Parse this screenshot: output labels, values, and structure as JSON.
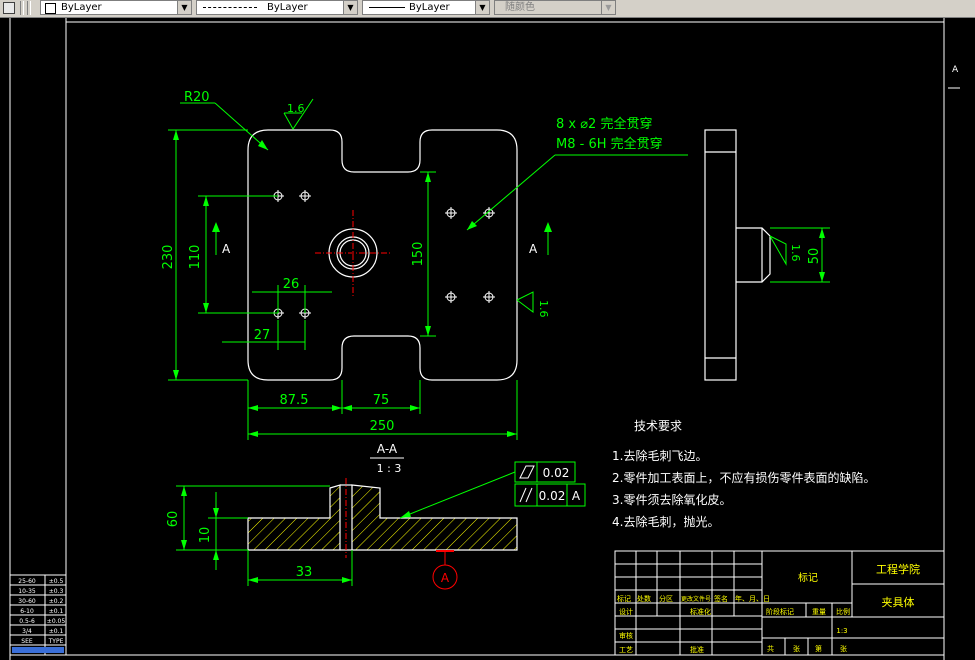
{
  "toolbar": {
    "color_combo": "ByLayer",
    "linetype_combo": "ByLayer",
    "lineweight_combo": "ByLayer",
    "plotstyle_combo": "随颜色"
  },
  "drawing": {
    "radius_label": "R20",
    "roughness_value": "1.6",
    "hole_note_line1": "8 x ⌀2 完全贯穿",
    "hole_note_line2": "M8 - 6H 完全贯穿",
    "dim_230": "230",
    "dim_110": "110",
    "dim_150": "150",
    "dim_26": "26",
    "dim_27": "27",
    "dim_87_5": "87.5",
    "dim_75": "75",
    "dim_250": "250",
    "dim_50": "50",
    "dim_60": "60",
    "dim_10": "10",
    "dim_33": "33",
    "section_arrow_label": "A",
    "section_title": "A-A",
    "section_scale": "1 : 3",
    "tol_flatness": "0.02",
    "tol_parallel": "0.02",
    "tol_datum": "A",
    "datum_label": "A"
  },
  "tech_req": {
    "title": "技术要求",
    "items": [
      "1.去除毛刺飞边。",
      "2.零件加工表面上，不应有损伤零件表面的缺陷。",
      "3.零件须去除氧化皮。",
      "4.去除毛刺，抛光。"
    ]
  },
  "title_block": {
    "school": "工程学院",
    "part_name": "夹具体",
    "mark": "标记",
    "row_labels": [
      "标记",
      "处数",
      "分区",
      "更改文件号",
      "签名",
      "年、月、日"
    ],
    "design": "设计",
    "standardize": "标准化",
    "stage_mark": "阶段标记",
    "weight": "重量",
    "scale_label": "比例",
    "scale_value": "1:3",
    "review": "审核",
    "process": "工艺",
    "approve": "批准",
    "sheets": [
      "共",
      "张",
      "第",
      "张"
    ]
  },
  "left_legend": [
    "25-60",
    "10-35",
    "30-60",
    "6-10",
    "0.5-6",
    "3/4",
    "SEE"
  ],
  "left_legend_right": [
    "±0.5",
    "±0.3",
    "±0.2",
    "±0.1",
    "±0.05",
    "±0.1",
    "TYPE"
  ]
}
